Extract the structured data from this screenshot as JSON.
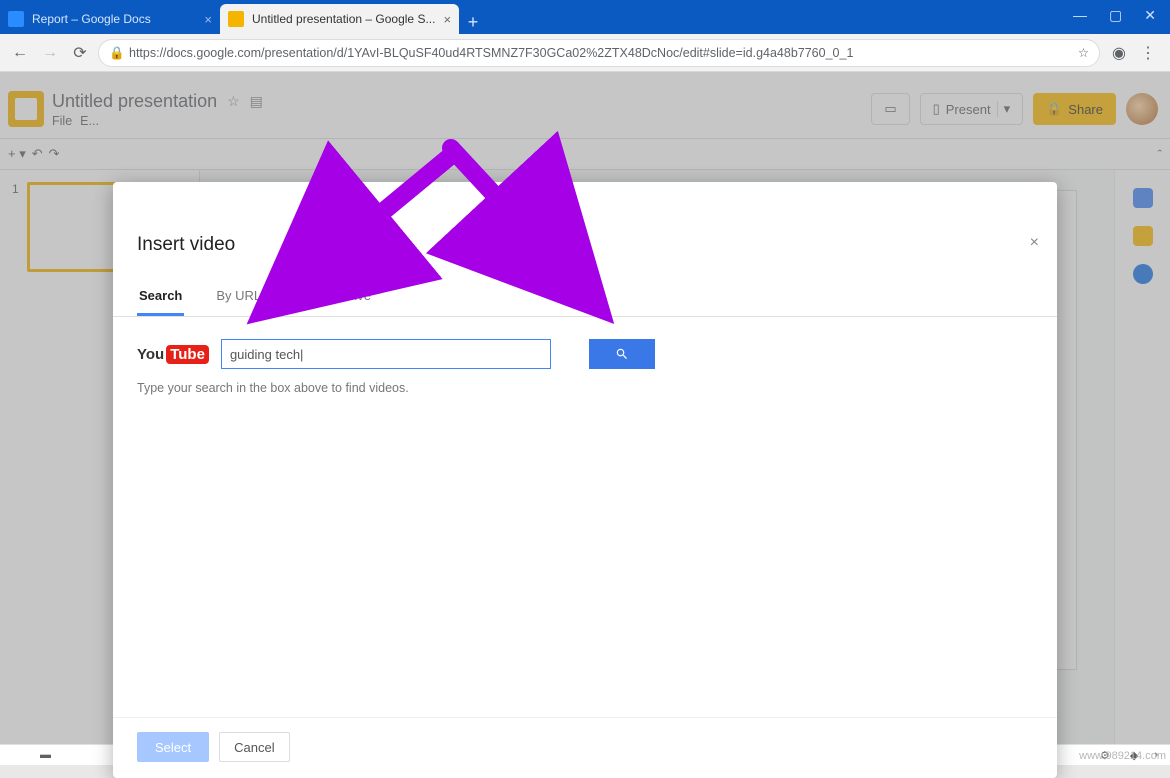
{
  "browser": {
    "tabs": [
      {
        "title": "Report – Google Docs"
      },
      {
        "title": "Untitled presentation – Google S..."
      }
    ],
    "url": "https://docs.google.com/presentation/d/1YAvI-BLQuSF40ud4RTSMNZ7F30GCa02%2ZTX48DcNoc/edit#slide=id.g4a48b7760_0_1"
  },
  "app": {
    "doc_title": "Untitled presentation",
    "menus": [
      "File",
      "E..."
    ],
    "header_buttons": {
      "present": "Present",
      "share": "Share"
    },
    "thumb_no": "1"
  },
  "modal": {
    "title": "Insert video",
    "tabs": {
      "search": "Search",
      "by_url": "By URL",
      "gdrive": "Google Drive"
    },
    "yt": {
      "you": "You",
      "tube": "Tube"
    },
    "search_value": "guiding tech|",
    "search_placeholder": "Search",
    "hint": "Type your search in the box above to find videos.",
    "buttons": {
      "select": "Select",
      "cancel": "Cancel"
    }
  },
  "watermark": "www.989214.com"
}
